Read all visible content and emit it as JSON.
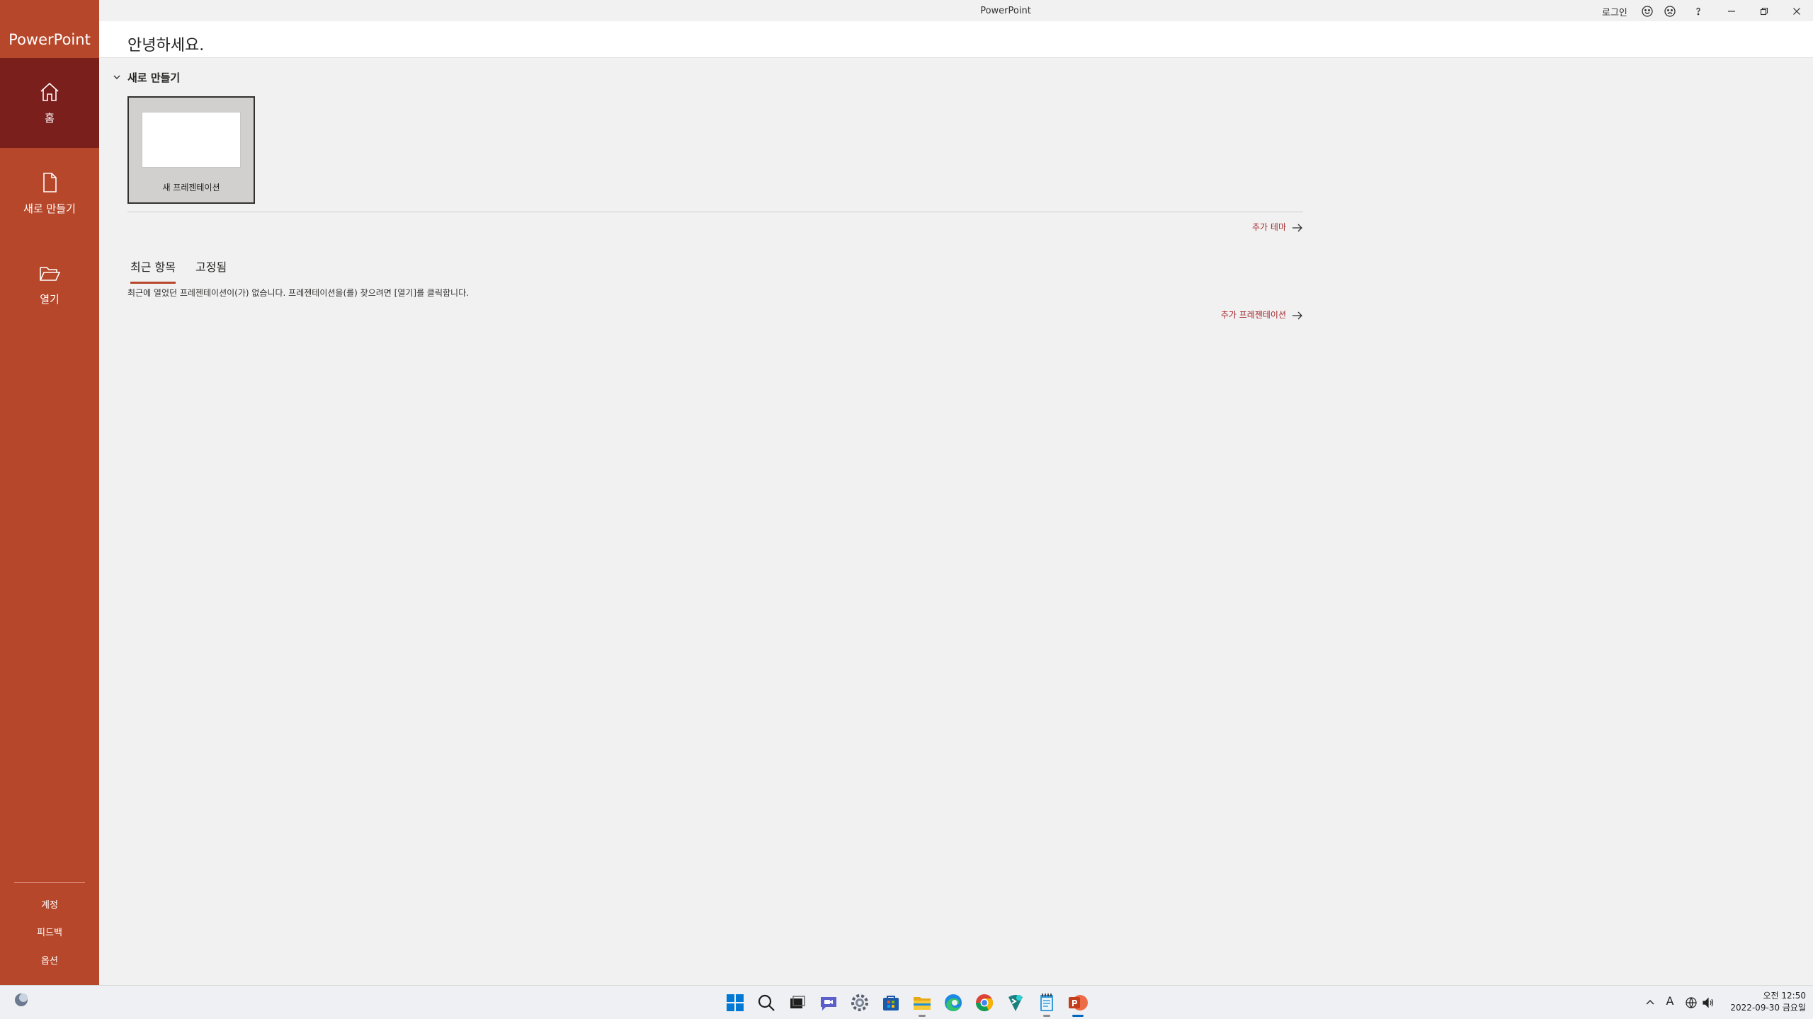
{
  "window": {
    "title": "PowerPoint",
    "login": "로그인"
  },
  "sidebar": {
    "brand": "PowerPoint",
    "items": [
      {
        "label": "홈",
        "icon": "home-icon",
        "active": true
      },
      {
        "label": "새로 만들기",
        "icon": "new-document-icon"
      },
      {
        "label": "열기",
        "icon": "open-folder-icon"
      }
    ],
    "footer": [
      "계정",
      "피드백",
      "옵션"
    ]
  },
  "header": {
    "greeting": "안녕하세요."
  },
  "new_section": {
    "heading": "새로 만들기",
    "template_label": "새 프레젠테이션",
    "more_themes": "추가 테마"
  },
  "recent": {
    "tabs": [
      "최근 항목",
      "고정됨"
    ],
    "empty_message": "최근에 열었던 프레젠테이션이(가) 없습니다. 프레젠테이션을(를) 찾으려면 [열기]를 클릭합니다.",
    "more_presentations": "추가 프레젠테이션"
  },
  "taskbar": {
    "apps": [
      "start-icon",
      "search-icon",
      "task-view-icon",
      "teams-chat-icon",
      "settings-icon",
      "store-icon",
      "file-explorer-icon",
      "edge-icon",
      "chrome-icon",
      "terminal-icon",
      "notepad-icon",
      "powerpoint-icon"
    ],
    "input_indicator": "A",
    "clock_time": "오전 12:50",
    "clock_date": "2022-09-30 금요일"
  },
  "colors": {
    "accent": "#b7472a",
    "accent_dark": "#7b1f1d",
    "link": "#a4262c"
  }
}
